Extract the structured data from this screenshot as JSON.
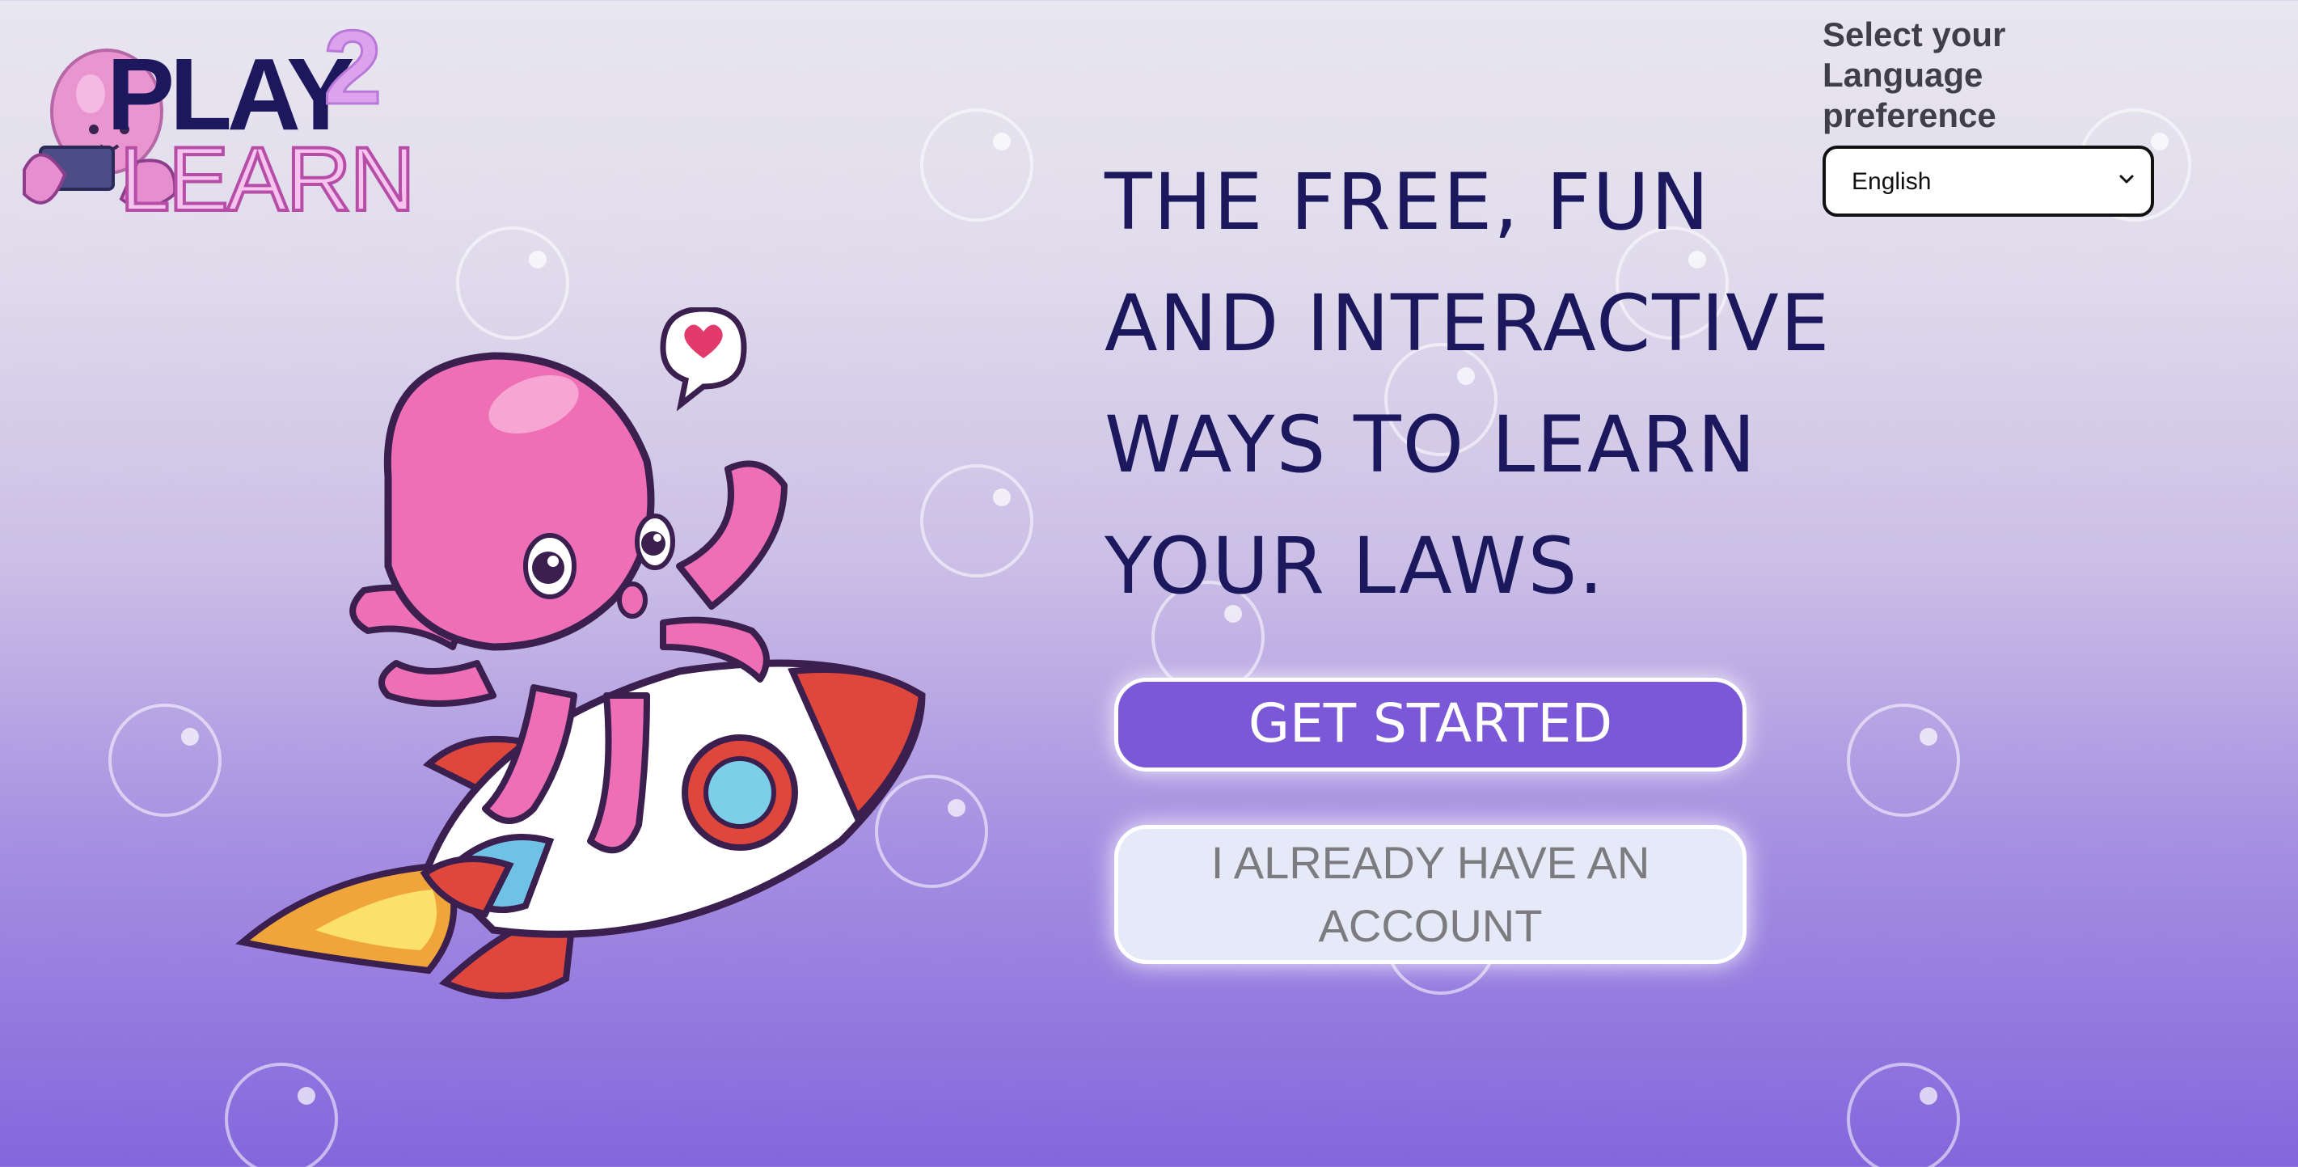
{
  "logo": {
    "word_play": "PLAY",
    "word_two": "2",
    "word_learn": "LEARN"
  },
  "language": {
    "label": "Select your Language preference",
    "selected": "English",
    "caret_icon": "chevron-down-icon"
  },
  "hero": {
    "headline": "THE FREE, FUN AND INTERACTIVE WAYS TO LEARN YOUR LAWS."
  },
  "actions": {
    "get_started_label": "GET STARTED",
    "have_account_label": "I ALREADY HAVE AN ACCOUNT"
  },
  "colors": {
    "headline": "#1b185d",
    "primary_button": "#7b58d7",
    "secondary_button": "#e6e9f7",
    "octopus_pink": "#ee6fb5",
    "background_bottom": "#8466dc"
  }
}
